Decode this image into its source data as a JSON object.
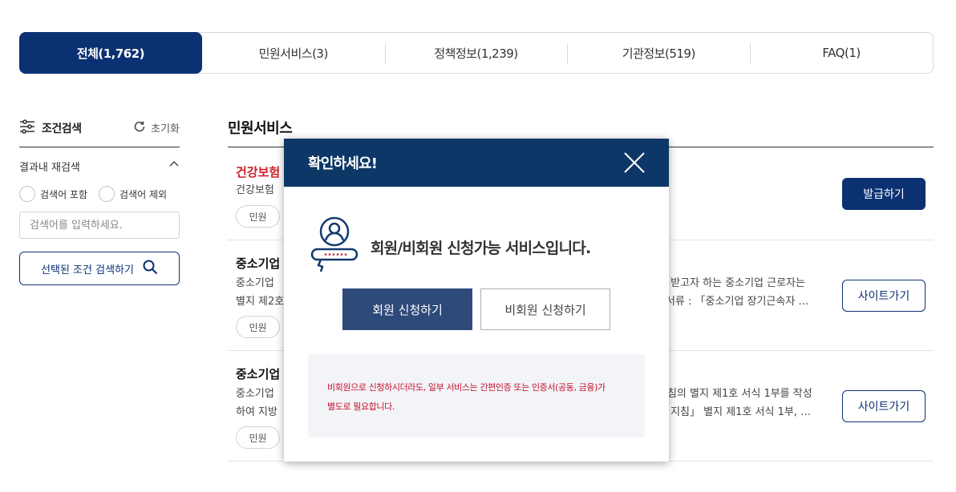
{
  "tabs": [
    {
      "label": "전체(1,762)",
      "active": true
    },
    {
      "label": "민원서비스(3)",
      "active": false
    },
    {
      "label": "정책정보(1,239)",
      "active": false
    },
    {
      "label": "기관정보(519)",
      "active": false
    },
    {
      "label": "FAQ(1)",
      "active": false
    }
  ],
  "sidebar": {
    "title": "조건검색",
    "reset": "초기화",
    "within_label": "결과내 재검색",
    "radio_include": "검색어 포함",
    "radio_exclude": "검색어 제외",
    "search_placeholder": "검색어를 입력하세요.",
    "search_button": "선택된 조건 검색하기"
  },
  "main": {
    "section_title": "민원서비스",
    "items": [
      {
        "title": "건강보험",
        "desc_left": "건강보험 ",
        "desc_right": "",
        "tag": "민원",
        "button": "발급하기"
      },
      {
        "title": "중소기업",
        "desc_left_1": "중소기업 ",
        "desc_left_2": "별지 제2호",
        "desc_right_1": "을 받고자 하는 중소기업 근로자는",
        "desc_right_2": "출서류 : 「중소기업 장기근속자 …",
        "tag": "민원",
        "button": "사이트가기"
      },
      {
        "title": "중소기업",
        "desc_left_1": "중소기업 ",
        "desc_left_2": "하여 지방",
        "desc_right_1": "지침의 별지 제1호 서식 1부를 작성",
        "desc_right_2": "한 지침」 별지 제1호 서식 1부, …",
        "tag": "민원",
        "button": "사이트가기"
      }
    ]
  },
  "modal": {
    "title": "확인하세요!",
    "message": "회원/비회원 신청가능 서비스입니다.",
    "member_button": "회원 신청하기",
    "nonmember_button": "비회원 신청하기",
    "notice_line1": "비회원으로 신청하시더라도, 일부 서비스는 간편인증 또는 인증서(공동, 금융)가",
    "notice_line2": "별도로 필요합니다."
  },
  "colors": {
    "primary": "#0c3173",
    "modal_header": "#0d3766",
    "accent_red": "#d0202a"
  }
}
